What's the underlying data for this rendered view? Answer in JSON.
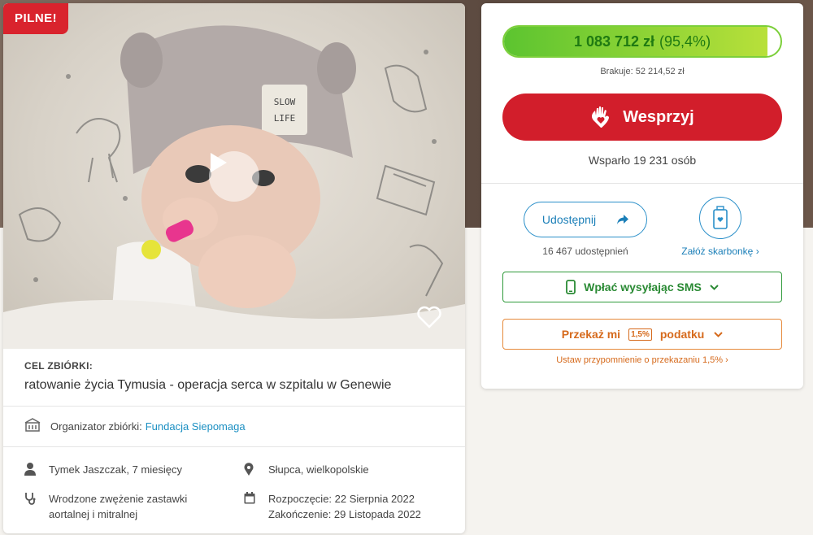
{
  "badge": {
    "label": "PILNE!"
  },
  "campaign": {
    "goal_label": "CEL ZBIÓRKI:",
    "goal_text": "ratowanie życia Tymusia - operacja serca w szpitalu w Genewie",
    "organizer_label": "Organizator zbiórki:",
    "organizer_name": "Fundacja Siepomaga",
    "details": {
      "person": "Tymek Jaszczak, 7 miesięcy",
      "location": "Słupca, wielkopolskie",
      "diagnosis_line1": "Wrodzone zwężenie zastawki",
      "diagnosis_line2": "aortalnej i mitralnej",
      "start": "Rozpoczęcie: 22 Sierpnia 2022",
      "end": "Zakończenie: 29 Listopada 2022"
    }
  },
  "donation": {
    "amount": "1 083 712 zł",
    "percent_label": "(95,4%)",
    "progress_fraction": 0.954,
    "missing": "Brakuje: 52 214,52 zł",
    "support_label": "Wesprzyj",
    "supporters": "Wsparło 19 231 osób",
    "share_label": "Udostępnij",
    "share_count": "16 467 udostępnień",
    "piggy_link": "Załóż skarbonkę",
    "sms_label": "Wpłać wysyłając SMS",
    "tax_label_pre": "Przekaż mi",
    "tax_pct": "1,5%",
    "tax_label_post": "podatku",
    "reminder": "Ustaw przypomnienie o przekazaniu 1,5%"
  },
  "colors": {
    "accent_red": "#d21e2b",
    "progress_green": "#5cc430",
    "link_blue": "#1b7fb8",
    "sms_green": "#2a8a34",
    "tax_orange": "#d66a1c"
  },
  "icons": [
    "play-icon",
    "heart-icon",
    "organizer-icon",
    "person-icon",
    "location-pin-icon",
    "stethoscope-icon",
    "calendar-icon",
    "hand-heart-icon",
    "share-arrow-icon",
    "piggy-bank-icon",
    "phone-icon",
    "chevron-down-icon",
    "chevron-right-icon"
  ]
}
